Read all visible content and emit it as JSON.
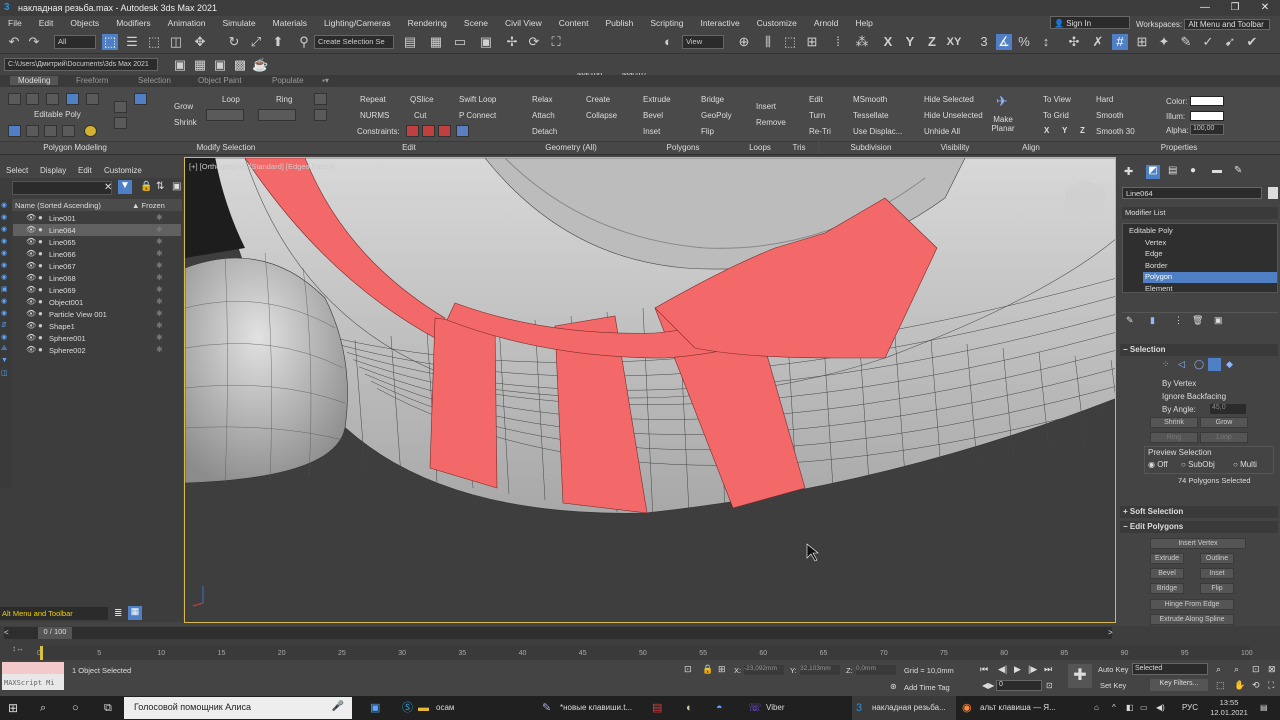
{
  "titlebar": {
    "title": "накладная резьба.max - Autodesk 3ds Max 2021",
    "minimize": "—",
    "maximize": "❐",
    "close": "✕"
  },
  "menu": [
    "File",
    "Edit",
    "Objects",
    "Modifiers",
    "Animation",
    "Simulate",
    "Materials",
    "Lighting/Cameras",
    "Rendering",
    "Scene",
    "Civil View",
    "Content",
    "Publish",
    "Scripting",
    "Interactive",
    "Customize",
    "Arnold",
    "Help"
  ],
  "signin": "Sign In",
  "workspaces": {
    "label": "Workspaces:",
    "value": "Alt Menu and Toolbar"
  },
  "toolbar": {
    "filter": "All",
    "selection_set": "Create Selection Se",
    "macro6": "Macro6",
    "macro7": "Macro7",
    "view": "View",
    "axis_x": "X",
    "axis_y": "Y",
    "axis_z": "Z",
    "axis_xy": "XY"
  },
  "path": "C:\\Users\\Дмитрий\\Documents\\3ds Max 2021",
  "tabs": {
    "modeling": "Modeling",
    "freeform": "Freeform",
    "selection": "Selection",
    "object_paint": "Object Paint",
    "populate": "Populate"
  },
  "ribbon": {
    "editable_poly": "Editable Poly",
    "grow": "Grow",
    "shrink": "Shrink",
    "loop": "Loop",
    "ring": "Ring",
    "repeat": "Repeat",
    "qslice": "QSlice",
    "swift_loop": "Swift Loop",
    "nurms": "NURMS",
    "cut": "Cut",
    "p_connect": "P Connect",
    "constraints": "Constraints:",
    "relax": "Relax",
    "create": "Create",
    "attach": "Attach",
    "collapse": "Collapse",
    "detach": "Detach",
    "extrude": "Extrude",
    "bridge": "Bridge",
    "bevel": "Bevel",
    "geopoly": "GeoPoly",
    "inset": "Inset",
    "flip": "Flip",
    "insert": "Insert",
    "remove": "Remove",
    "edit": "Edit",
    "turn": "Turn",
    "retri": "Re-Tri",
    "msmooth": "MSmooth",
    "tessellate": "Tessellate",
    "use_displac": "Use Displac...",
    "hide_selected": "Hide Selected",
    "hide_unselected": "Hide Unselected",
    "unhide_all": "Unhide All",
    "make_planar": "Make Planar",
    "to_view": "To View",
    "to_grid": "To Grid",
    "x": "X",
    "y": "Y",
    "z": "Z",
    "hard": "Hard",
    "smooth": "Smooth",
    "smooth30": "Smooth 30",
    "color": "Color:",
    "illum": "Illum:",
    "alpha": "Alpha:",
    "alpha_val": "100,00",
    "sections": [
      "Polygon Modeling",
      "Modify Selection",
      "Edit",
      "Geometry (All)",
      "Polygons",
      "Loops",
      "Tris",
      "Subdivision",
      "Visibility",
      "Align",
      "Properties"
    ]
  },
  "scene_explorer": {
    "menu": [
      "Select",
      "Display",
      "Edit",
      "Customize"
    ],
    "col_name": "Name (Sorted Ascending)",
    "col_frozen": "▲ Frozen",
    "objects": [
      "Line001",
      "Line064",
      "Line065",
      "Line066",
      "Line067",
      "Line068",
      "Line069",
      "Object001",
      "Particle View 001",
      "Shape1",
      "Sphere001",
      "Sphere002"
    ],
    "selected_index": 1
  },
  "viewport": {
    "label": "[+] [Orthographic] [Standard] [Edged Faces]"
  },
  "command_panel": {
    "object_name": "Line064",
    "modifier_list": "Modifier List",
    "stack": [
      "Editable Poly",
      "Vertex",
      "Edge",
      "Border",
      "Polygon",
      "Element"
    ],
    "active": "Polygon",
    "selection_title": "Selection",
    "by_vertex": "By Vertex",
    "ignore_backfacing": "Ignore Backfacing",
    "by_angle": "By Angle:",
    "angle_val": "45,0",
    "shrink": "Shrink",
    "grow": "Grow",
    "ring": "Ring",
    "loop": "Loop",
    "preview": "Preview Selection",
    "off": "Off",
    "subobj": "SubObj",
    "multi": "Multi",
    "count": "74 Polygons Selected",
    "soft_selection": "Soft Selection",
    "edit_polygons": "Edit Polygons",
    "insert_vertex": "Insert Vertex",
    "extrude": "Extrude",
    "outline": "Outline",
    "bevel": "Bevel",
    "inset": "Inset",
    "bridge": "Bridge",
    "flip": "Flip",
    "hinge": "Hinge From Edge",
    "extrude_spline": "Extrude Along Spline"
  },
  "bottom": {
    "workspace_dd": "Alt Menu and Toolbar",
    "frame": "0 / 100",
    "ticks": [
      "0",
      "5",
      "10",
      "15",
      "20",
      "25",
      "30",
      "35",
      "40",
      "45",
      "50",
      "55",
      "60",
      "65",
      "70",
      "75",
      "80",
      "85",
      "90",
      "95",
      "100"
    ],
    "maxscript": "MAXScript Mi",
    "status": "1 Object Selected",
    "x_label": "X:",
    "x_val": "-23,092mm",
    "y_label": "Y:",
    "y_val": "32,103mm",
    "z_label": "Z:",
    "z_val": "0,0mm",
    "grid": "Grid = 10,0mm",
    "add_time_tag": "Add Time Tag",
    "auto_key": "Auto Key",
    "selected": "Selected",
    "set_key": "Set Key",
    "key_filters": "Key Filters...",
    "frame_num": "0"
  },
  "taskbar": {
    "search": "Голосовой помощник Алиса",
    "app1": "осам",
    "app2": "*новые клавиши.t...",
    "viber": "Viber",
    "max": "накладная резьба...",
    "firefox": "альт клавиша — Я...",
    "lang": "РУС",
    "time": "13:55",
    "date": "12.01.2021"
  },
  "colors": {
    "accent": "#4f7fc4",
    "selected_faces": "#f36868",
    "viewport_border": "#d7b84a"
  }
}
